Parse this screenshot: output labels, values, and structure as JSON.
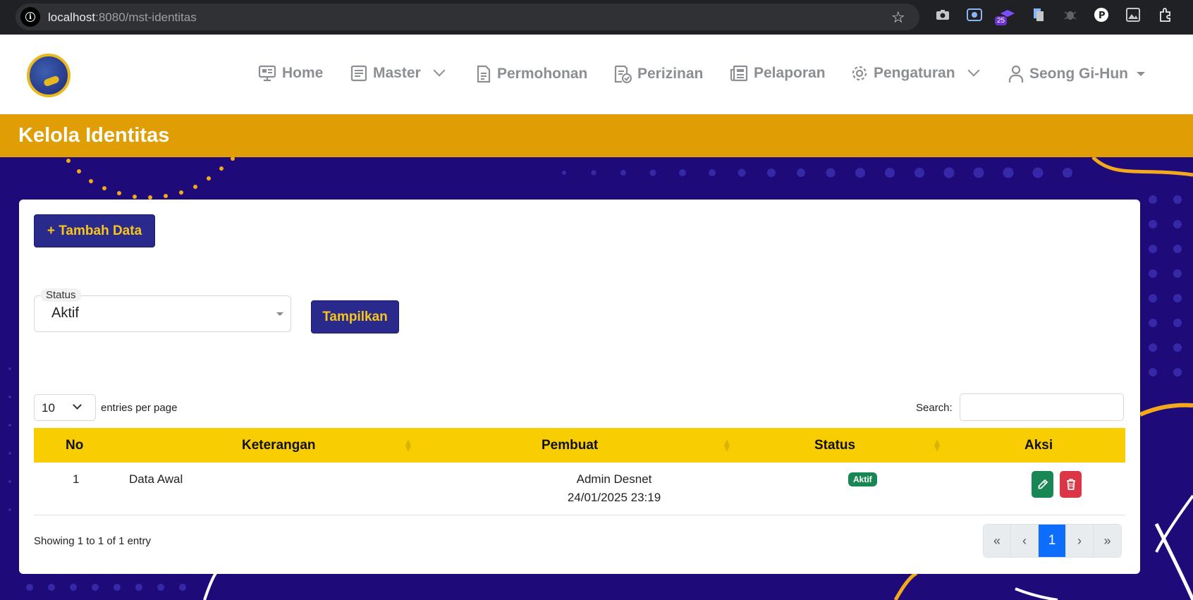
{
  "browser": {
    "url_host": "localhost",
    "url_path": ":8080/mst-identitas",
    "extension_badge": "25"
  },
  "nav": {
    "items": [
      {
        "label": "Home",
        "icon": "monitor-icon"
      },
      {
        "label": "Master",
        "icon": "list-icon"
      },
      {
        "label": "Permohonan",
        "icon": "document-icon"
      },
      {
        "label": "Perizinan",
        "icon": "document-check-icon"
      },
      {
        "label": "Pelaporan",
        "icon": "newspaper-icon"
      },
      {
        "label": "Pengaturan",
        "icon": "gear-icon"
      }
    ],
    "user": "Seong Gi-Hun"
  },
  "page": {
    "title": "Kelola Identitas",
    "add_button": "+ Tambah Data",
    "filter": {
      "label": "Status",
      "value": "Aktif",
      "submit": "Tampilkan"
    },
    "entries": {
      "value": "10",
      "text": "entries per page"
    },
    "search_label": "Search:",
    "table": {
      "columns": [
        "No",
        "Keterangan",
        "Pembuat",
        "Status",
        "Aksi"
      ],
      "rows": [
        {
          "no": "1",
          "keterangan": "Data Awal",
          "pembuat": "Admin Desnet",
          "tanggal": "24/01/2025 23:19",
          "status": "Aktif"
        }
      ]
    },
    "info": "Showing 1 to 1 of 1 entry",
    "pagination": [
      "«",
      "‹",
      "1",
      "›",
      "»"
    ]
  },
  "colors": {
    "header_band": "#e09d04",
    "primary_button": "#2a2a8c",
    "button_text": "#f7c61a",
    "table_header": "#f8cd02",
    "background": "#1f0a7a"
  }
}
